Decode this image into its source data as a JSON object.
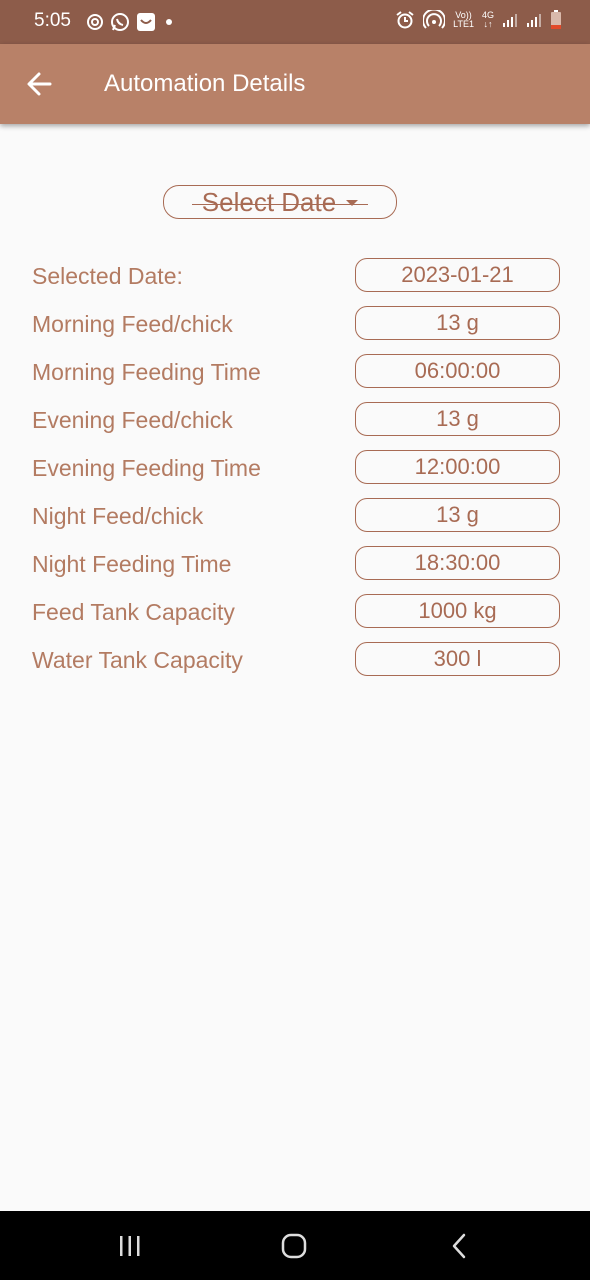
{
  "status_bar": {
    "time": "5:05",
    "network_top": "Vo))",
    "network_bottom": "LTE1",
    "network_type": "4G",
    "icons": [
      "focus-icon",
      "whatsapp-icon",
      "message-icon",
      "dot-icon",
      "alarm-icon",
      "hotspot-icon",
      "signal-icon",
      "signal-icon",
      "battery-icon"
    ]
  },
  "app_bar": {
    "title": "Automation Details",
    "back_icon": "arrow-back-icon"
  },
  "date_picker": {
    "label": "Select Date",
    "icon": "dropdown-caret-icon"
  },
  "details": [
    {
      "label": "Selected Date:",
      "value": "2023-01-21"
    },
    {
      "label": "Morning Feed/chick",
      "value": "13 g"
    },
    {
      "label": "Morning Feeding Time",
      "value": "06:00:00"
    },
    {
      "label": "Evening Feed/chick",
      "value": "13 g"
    },
    {
      "label": "Evening Feeding Time",
      "value": "12:00:00"
    },
    {
      "label": "Night Feed/chick",
      "value": "13 g"
    },
    {
      "label": "Night Feeding Time",
      "value": "18:30:00"
    },
    {
      "label": "Feed Tank Capacity",
      "value": "1000 kg"
    },
    {
      "label": "Water Tank Capacity",
      "value": "300 l"
    }
  ],
  "colors": {
    "status_bar": "#8d5c4a",
    "app_bar": "#b88168",
    "accent": "#a86b54",
    "label_text": "#b37b62",
    "background": "#fafafa"
  }
}
